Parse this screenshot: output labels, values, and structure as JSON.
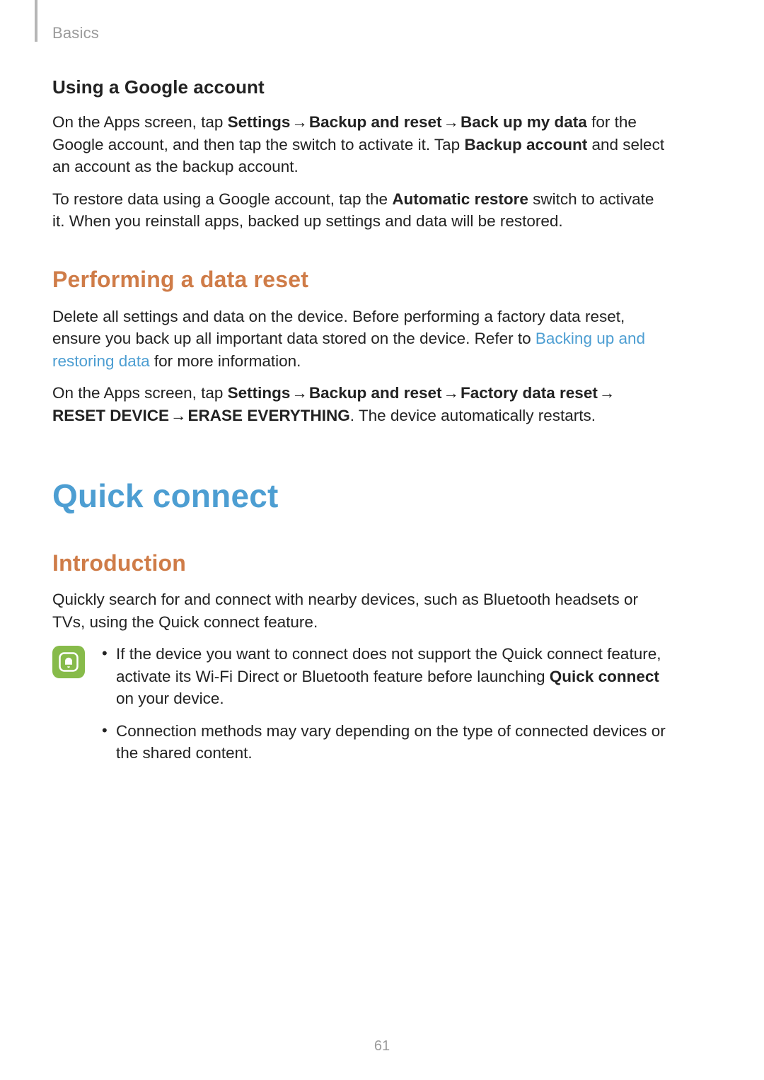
{
  "header": {
    "section": "Basics"
  },
  "google": {
    "heading": "Using a Google account",
    "p1_pre": "On the Apps screen, tap ",
    "p1_settings": "Settings",
    "p1_arrow": " → ",
    "p1_backup_reset": "Backup and reset",
    "p1_backup_my_data": "Back up my data",
    "p1_mid": " for the Google account, and then tap the switch to activate it. Tap ",
    "p1_backup_account": "Backup account",
    "p1_end": " and select an account as the backup account.",
    "p2_pre": "To restore data using a Google account, tap the ",
    "p2_auto_restore": "Automatic restore",
    "p2_end": " switch to activate it. When you reinstall apps, backed up settings and data will be restored."
  },
  "reset": {
    "heading": "Performing a data reset",
    "p1_pre": "Delete all settings and data on the device. Before performing a factory data reset, ensure you back up all important data stored on the device. Refer to ",
    "p1_link": "Backing up and restoring data",
    "p1_end": " for more information.",
    "p2_pre": "On the Apps screen, tap ",
    "p2_settings": "Settings",
    "p2_arrow": " → ",
    "p2_backup_reset": "Backup and reset",
    "p2_factory": "Factory data reset",
    "p2_reset_device": "RESET DEVICE",
    "p2_erase": "ERASE EVERYTHING",
    "p2_end": ". The device automatically restarts."
  },
  "quick_connect": {
    "title": "Quick connect",
    "intro_heading": "Introduction",
    "intro_para": "Quickly search for and connect with nearby devices, such as Bluetooth headsets or TVs, using the Quick connect feature.",
    "note1_pre": "If the device you want to connect does not support the Quick connect feature, activate its Wi-Fi Direct or Bluetooth feature before launching ",
    "note1_bold": "Quick connect",
    "note1_end": " on your device.",
    "note2": "Connection methods may vary depending on the type of connected devices or the shared content."
  },
  "page_number": "61"
}
